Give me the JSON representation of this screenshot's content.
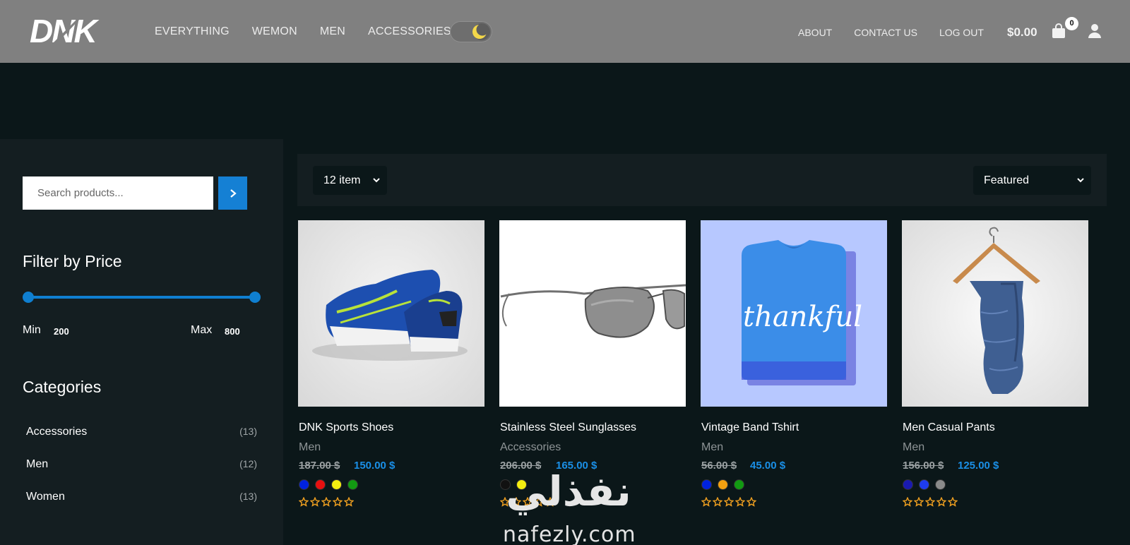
{
  "brand": "DNK",
  "nav": {
    "items": [
      "EVERYTHING",
      "WEMON",
      "MEN",
      "ACCESSORIES"
    ]
  },
  "theme_toggle": {
    "state": "dark"
  },
  "right_nav": {
    "about": "ABOUT",
    "contact": "CONTACT US",
    "logout": "LOG OUT"
  },
  "cart": {
    "total": "$0.00",
    "count": "0"
  },
  "search": {
    "placeholder": "Search products..."
  },
  "price_filter": {
    "title": "Filter by Price",
    "min_label": "Min",
    "min_value": "200",
    "max_label": "Max",
    "max_value": "800"
  },
  "categories": {
    "title": "Categories",
    "items": [
      {
        "name": "Accessories",
        "count": "(13)"
      },
      {
        "name": "Men",
        "count": "(12)"
      },
      {
        "name": "Women",
        "count": "(13)"
      }
    ]
  },
  "toolbar": {
    "per_page": "12 item",
    "sort": "Featured"
  },
  "products": [
    {
      "name": "DNK Sports Shoes",
      "category": "Men",
      "old_price": "187.00 $",
      "price": "150.00 $",
      "colors": [
        "#0022e0",
        "#e81010",
        "#f4ee10",
        "#129a12"
      ],
      "rating": 0
    },
    {
      "name": "Stainless Steel Sunglasses",
      "category": "Accessories",
      "old_price": "206.00 $",
      "price": "165.00 $",
      "colors": [
        "#111111",
        "#f4ee10"
      ],
      "rating": 0
    },
    {
      "name": "Vintage Band Tshirt",
      "category": "Men",
      "old_price": "56.00 $",
      "price": "45.00 $",
      "colors": [
        "#0022e0",
        "#f2a010",
        "#129a12"
      ],
      "rating": 0
    },
    {
      "name": "Men Casual Pants",
      "category": "Men",
      "old_price": "156.00 $",
      "price": "125.00 $",
      "colors": [
        "#1a1ab0",
        "#1e3cf0",
        "#8a8a8a"
      ],
      "rating": 0
    }
  ],
  "product_image_text": {
    "tshirt_print": "thankful"
  },
  "watermark": {
    "arabic": "نفذلي",
    "latin": "nafezly.com"
  },
  "colors": {
    "accent": "#1580d4",
    "price": "#1a8fe6",
    "star": "#f0a020",
    "header": "#808080",
    "page_bg": "#0b1719",
    "panel_bg": "#141e21"
  }
}
